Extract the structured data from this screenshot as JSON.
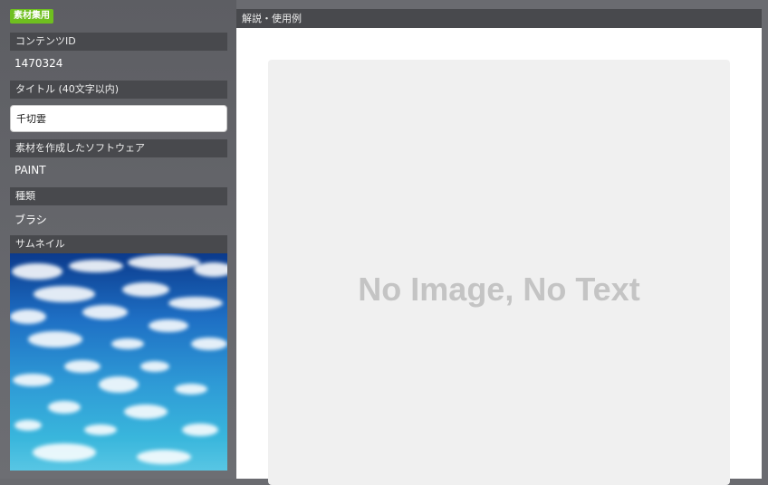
{
  "badge": "素材集用",
  "content_id": {
    "label": "コンテンツID",
    "value": "1470324"
  },
  "title": {
    "label": "タイトル (40文字以内)",
    "value": "千切雲"
  },
  "software": {
    "label": "素材を作成したソフトウェア",
    "value": "PAINT"
  },
  "kind": {
    "label": "種類",
    "value": "ブラシ"
  },
  "thumbnail": {
    "label": "サムネイル"
  },
  "description": {
    "label": "解説・使用例",
    "placeholder_text": "No Image, No Text"
  },
  "colors": {
    "badge": "#6fbf1f",
    "section_header": "#48494d",
    "sidebar": "#5d5e63",
    "placeholder_bg": "#f0f0f0"
  }
}
